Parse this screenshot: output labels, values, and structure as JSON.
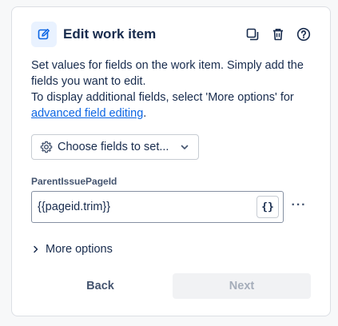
{
  "header": {
    "title": "Edit work item",
    "edit_icon": "edit-pencil-icon",
    "actions": [
      {
        "name": "duplicate-icon"
      },
      {
        "name": "trash-icon"
      },
      {
        "name": "help-icon"
      }
    ]
  },
  "description": {
    "line1": "Set values for fields on the work item. Simply add the fields you want to edit.",
    "line2": "To display additional fields, select 'More options' for",
    "link": "advanced field editing",
    "tail": "."
  },
  "choose_fields": {
    "label": "Choose fields to set...",
    "icon": "gear-icon",
    "chevron": "chevron-down-icon"
  },
  "field": {
    "label": "ParentIssuePageId",
    "value": "{{pageid.trim}}",
    "smart_value_label": "{}",
    "more_label": "···"
  },
  "more_options": {
    "label": "More options",
    "chevron": "chevron-right-icon"
  },
  "footer": {
    "back_label": "Back",
    "next_label": "Next"
  },
  "colors": {
    "accent": "#0c66e4",
    "icon_bg": "#e9f2ff",
    "text": "#172b4d"
  }
}
